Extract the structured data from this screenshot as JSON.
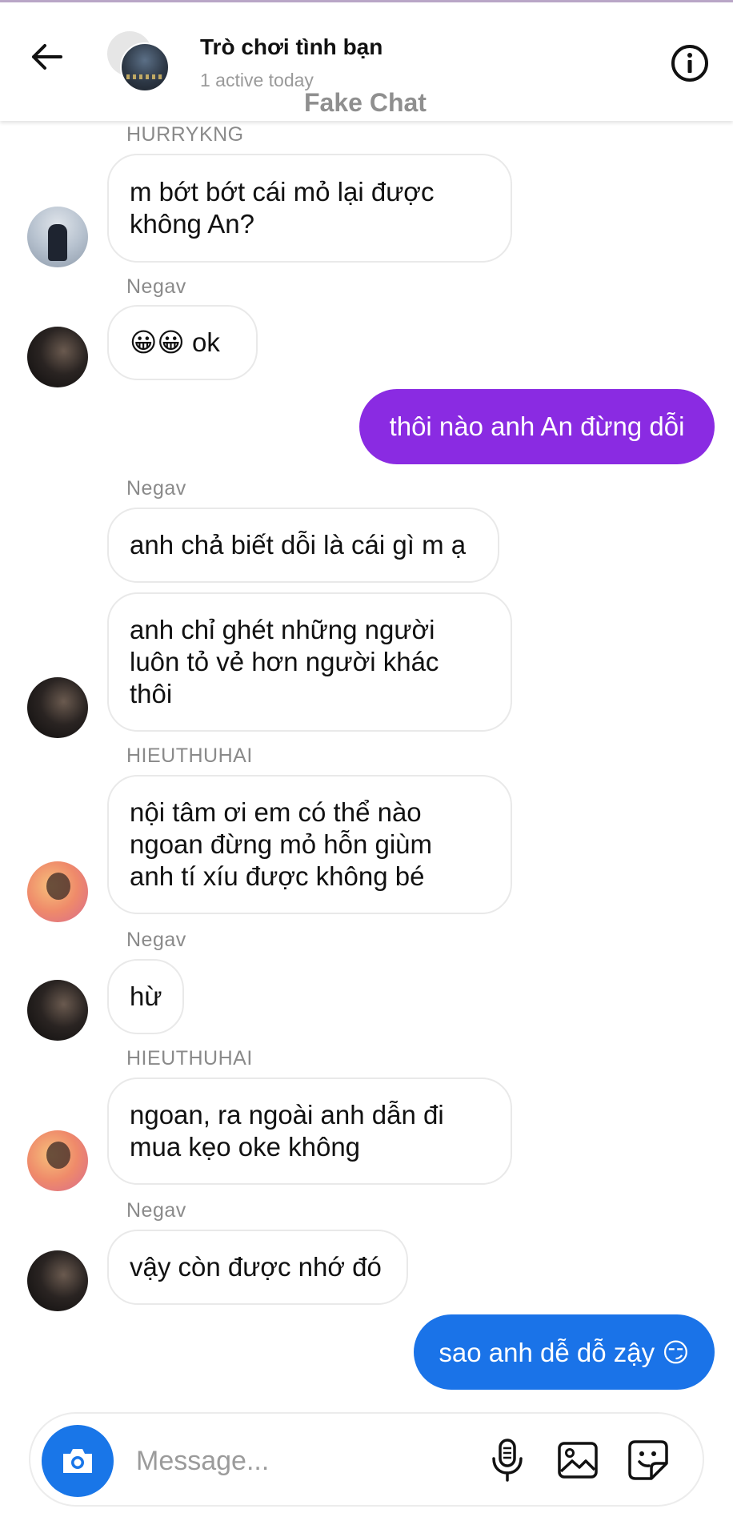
{
  "header": {
    "title": "Trò chơi tình bạn",
    "subtitle": "1 active today",
    "watermark": "Fake Chat",
    "back_icon": "arrow-left-icon",
    "info_icon": "info-icon"
  },
  "messages": [
    {
      "sender": "HURRYKNG",
      "lines": [
        "m bớt bớt cái mỏ lại được",
        "không An?"
      ]
    },
    {
      "sender": "Negav",
      "lines": [
        "😀😀 ok"
      ]
    },
    {
      "outgoing": true,
      "text": "thôi nào anh An đừng dỗi",
      "color": "#8a2be2"
    },
    {
      "sender": "Negav",
      "lines": [
        "anh chả biết dỗi là cái gì m ạ"
      ]
    },
    {
      "lines": [
        "anh chỉ ghét những người",
        "luôn tỏ vẻ hơn người khác",
        "thôi"
      ]
    },
    {
      "sender": "HIEUTHUHAI",
      "lines": [
        "nội tâm ơi em có thể nào",
        "ngoan đừng mỏ hỗn giùm",
        "anh tí xíu được không bé"
      ]
    },
    {
      "sender": "Negav",
      "lines": [
        "hừ"
      ]
    },
    {
      "sender": "HIEUTHUHAI",
      "lines": [
        "ngoan, ra ngoài anh dẫn đi",
        "mua kẹo oke không"
      ]
    },
    {
      "sender": "Negav",
      "lines": [
        "vậy còn được nhớ đó"
      ]
    },
    {
      "outgoing": true,
      "text": "sao anh dễ dỗ zậy 😏",
      "color": "#1a73e8"
    }
  ],
  "composer": {
    "placeholder": "Message...",
    "icons": [
      "camera-icon",
      "microphone-icon",
      "image-icon",
      "sticker-icon"
    ]
  },
  "colors": {
    "accent_purple": "#8a2be2",
    "accent_blue": "#1a73e8"
  }
}
